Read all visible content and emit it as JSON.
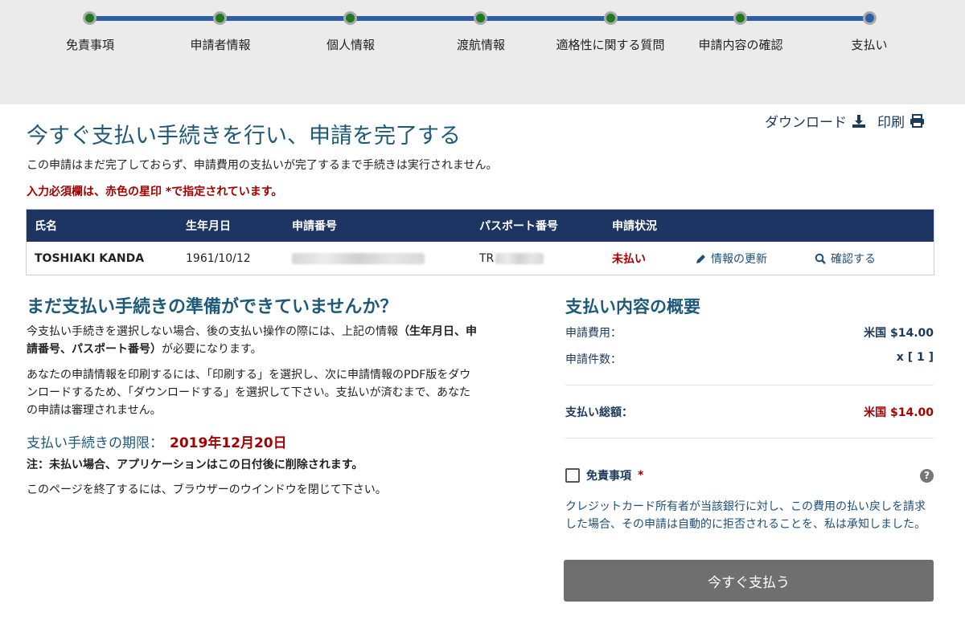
{
  "progress": {
    "steps": [
      {
        "label": "免責事項"
      },
      {
        "label": "申請者情報"
      },
      {
        "label": "個人情報"
      },
      {
        "label": "渡航情報"
      },
      {
        "label": "適格性に関する質問"
      },
      {
        "label": "申請内容の確認"
      },
      {
        "label": "支払い"
      }
    ],
    "current_step": 7
  },
  "header": {
    "title": "今すぐ支払い手続きを行い、申請を完了する",
    "download_label": "ダウンロード",
    "print_label": "印刷",
    "subtitle": "この申請はまだ完了しておらず、申請費用の支払いが完了するまで手続きは実行されません。",
    "required_note": "入力必須欄は、赤色の星印 *で指定されています。"
  },
  "applicant_table": {
    "headers": [
      "氏名",
      "生年月日",
      "申請番号",
      "パスポート番号",
      "申請状況"
    ],
    "row": {
      "name": "TOSHIAKI KANDA",
      "dob": "1961/10/12",
      "passport_prefix": "TR",
      "status": "未払い",
      "update_link": "情報の更新",
      "confirm_link": "確認する"
    }
  },
  "left": {
    "heading": "まだ支払い手続きの準備ができていませんか？",
    "para1_a": "今支払い手続きを選択しない場合、後の支払い操作の際には、上記の情報",
    "para1_b": "（生年月日、申請番号、パスポート番号）",
    "para1_c": "が必要になります。",
    "para2": "あなたの申請情報を印刷するには、「印刷する」を選択し、次に申請情報のPDF版をダウンロードするため、「ダウンロードする」を選択して下さい。支払いが済むまで、あなたの申請は審理されません。",
    "deadline_label": "支払い手続きの期限：",
    "deadline_date": "2019年12月20日",
    "note": "注：未払い場合、アプリケーションはこの日付後に削除されます。",
    "close_note": "このページを終了するには、ブラウザーのウインドウを閉じて下さい。"
  },
  "summary": {
    "heading": "支払い内容の概要",
    "fee_label": "申請費用：",
    "fee_value": "米国 $14.00",
    "count_label": "申請件数：",
    "count_value": "x [ 1 ]",
    "total_label": "支払い総額：",
    "total_value": "米国 $14.00",
    "disclaimer_label": "免責事項",
    "disclaimer_required": "*",
    "disclaimer_text": "クレジットカード所有者が当該銀行に対し、この費用の払い戻しを請求した場合、その申請は自動的に拒否されることを、私は承知しました。",
    "pay_button": "今すぐ支払う"
  },
  "colors": {
    "accent_blue": "#1d5a7a",
    "table_header": "#1d3562",
    "error_red": "#a40000",
    "step_done": "#1f7a1f",
    "track": "#2f5fa0"
  }
}
